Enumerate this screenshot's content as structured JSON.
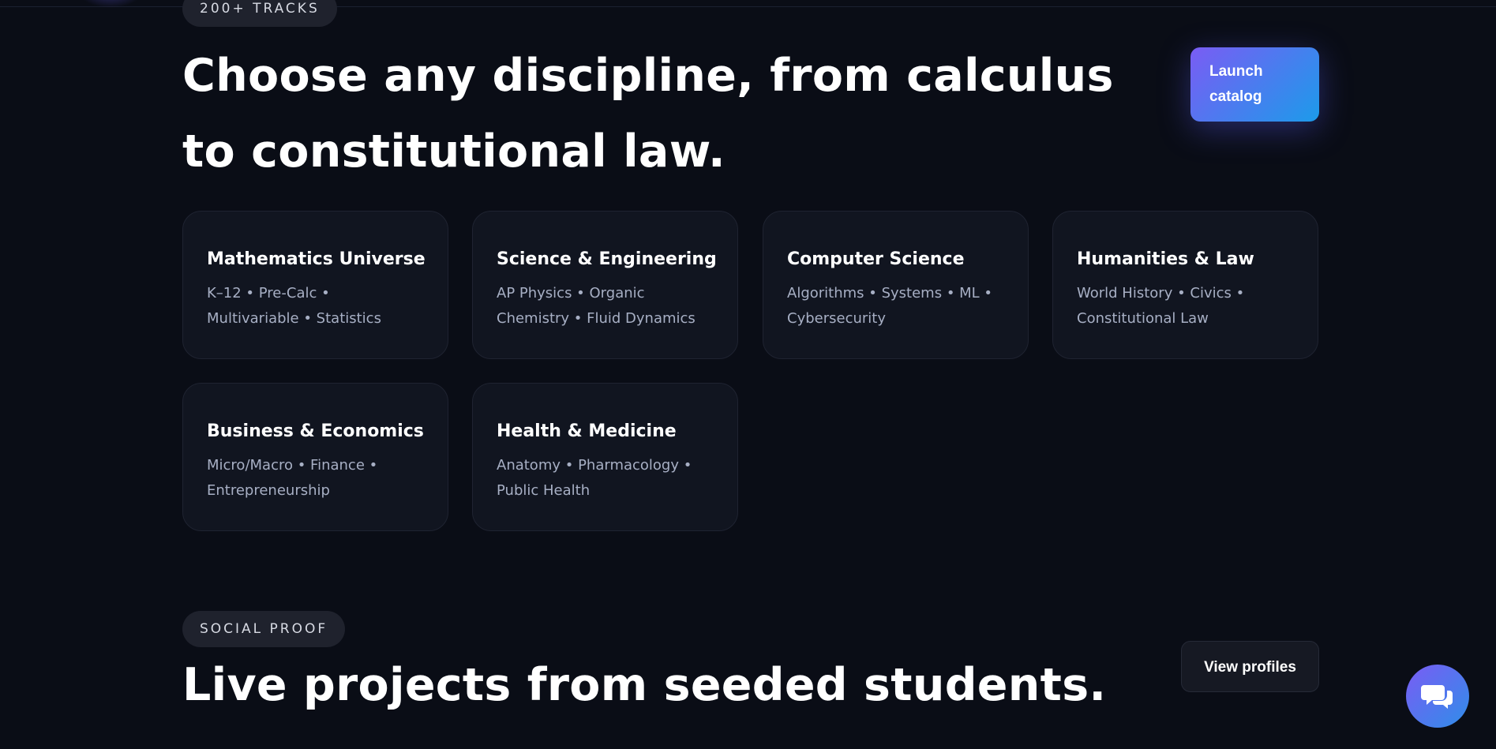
{
  "tracks_section": {
    "pill_label": "200+ TRACKS",
    "headline": "Choose any discipline, from calculus to constitutional law.",
    "launch_button_label": "Launch catalog",
    "cards": [
      {
        "title": "Mathematics Universe",
        "description": "K–12 • Pre-Calc • Multivariable • Statistics"
      },
      {
        "title": "Science & Engineering",
        "description": "AP Physics • Organic Chemistry • Fluid Dynamics"
      },
      {
        "title": "Computer Science",
        "description": "Algorithms • Systems • ML • Cybersecurity"
      },
      {
        "title": "Humanities & Law",
        "description": "World History • Civics • Constitutional Law"
      },
      {
        "title": "Business & Economics",
        "description": "Micro/Macro • Finance • Entrepreneurship"
      },
      {
        "title": "Health & Medicine",
        "description": "Anatomy • Pharmacology • Public Health"
      }
    ]
  },
  "social_section": {
    "pill_label": "SOCIAL PROOF",
    "headline": "Live projects from seeded students.",
    "view_button_label": "View profiles"
  },
  "chat": {
    "icon": "chat-bubbles-icon"
  },
  "colors": {
    "background": "#0a0d16",
    "card_background": "#111520",
    "accent_start": "#7a5cf4",
    "accent_end": "#1c9bea"
  }
}
